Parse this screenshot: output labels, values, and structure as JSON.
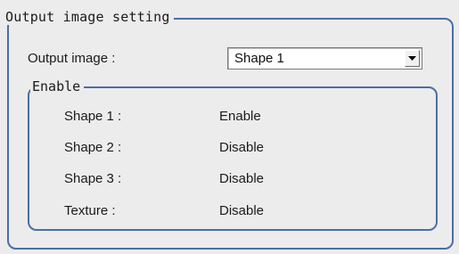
{
  "output_image_setting": {
    "title": "Output image setting",
    "output_image_label": "Output image :",
    "output_image_value": "Shape 1",
    "dropdown_icon": "chevron-down-icon"
  },
  "enable_group": {
    "title": "Enable",
    "rows": [
      {
        "label": "Shape 1 :",
        "value": "Enable"
      },
      {
        "label": "Shape 2 :",
        "value": "Disable"
      },
      {
        "label": "Shape 3 :",
        "value": "Disable"
      },
      {
        "label": "Texture :",
        "value": "Disable"
      }
    ]
  },
  "colors": {
    "group_border": "#4a6fa5",
    "panel_background": "#ececec"
  }
}
